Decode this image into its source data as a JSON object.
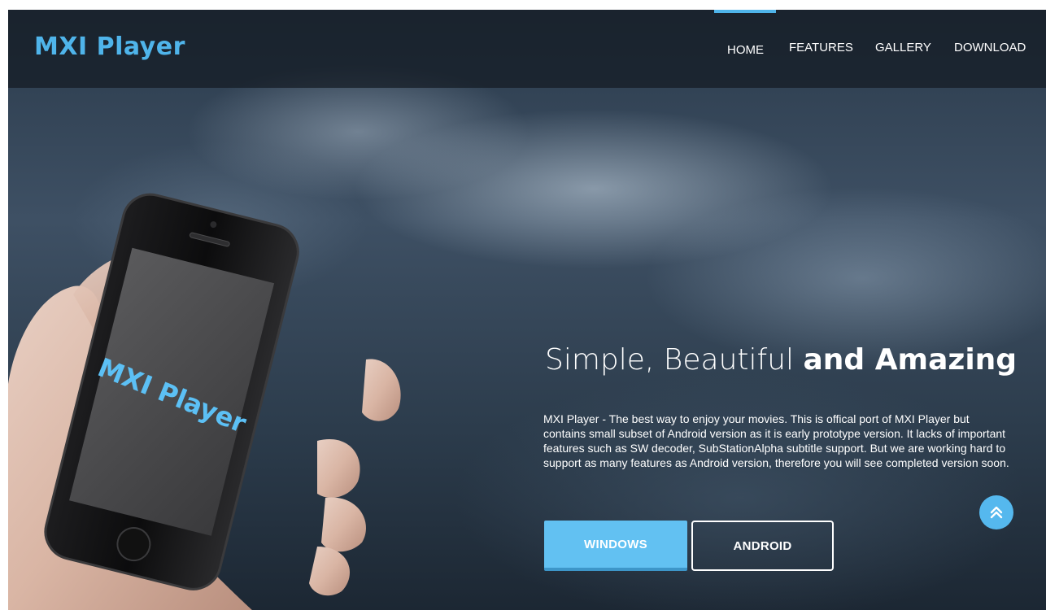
{
  "header": {
    "logo": "MXI Player",
    "nav": [
      {
        "label": "HOME",
        "active": true
      },
      {
        "label": "FEATURES",
        "active": false
      },
      {
        "label": "GALLERY",
        "active": false
      },
      {
        "label": "DOWNLOAD",
        "active": false
      }
    ]
  },
  "hero": {
    "phone_screen_text": "MXI Player",
    "title_regular": "Simple, Beautiful ",
    "title_bold": "and Amazing",
    "description": "MXI Player - The best way to enjoy your movies. This is offical port of MXI Player but contains small subset of Android version as it is early prototype version. It lacks of important features such as SW decoder, SubStationAlpha subtitle support. But we are working hard to support as many features as Android version, therefore you will see completed version soon.",
    "buttons": {
      "windows": "WINDOWS",
      "android": "ANDROID"
    }
  },
  "colors": {
    "accent": "#4fb4ea",
    "button_primary": "#62c1f2",
    "nav_bg": "#141a22"
  },
  "icons": {
    "scroll_top": "double-chevron-up-icon"
  }
}
